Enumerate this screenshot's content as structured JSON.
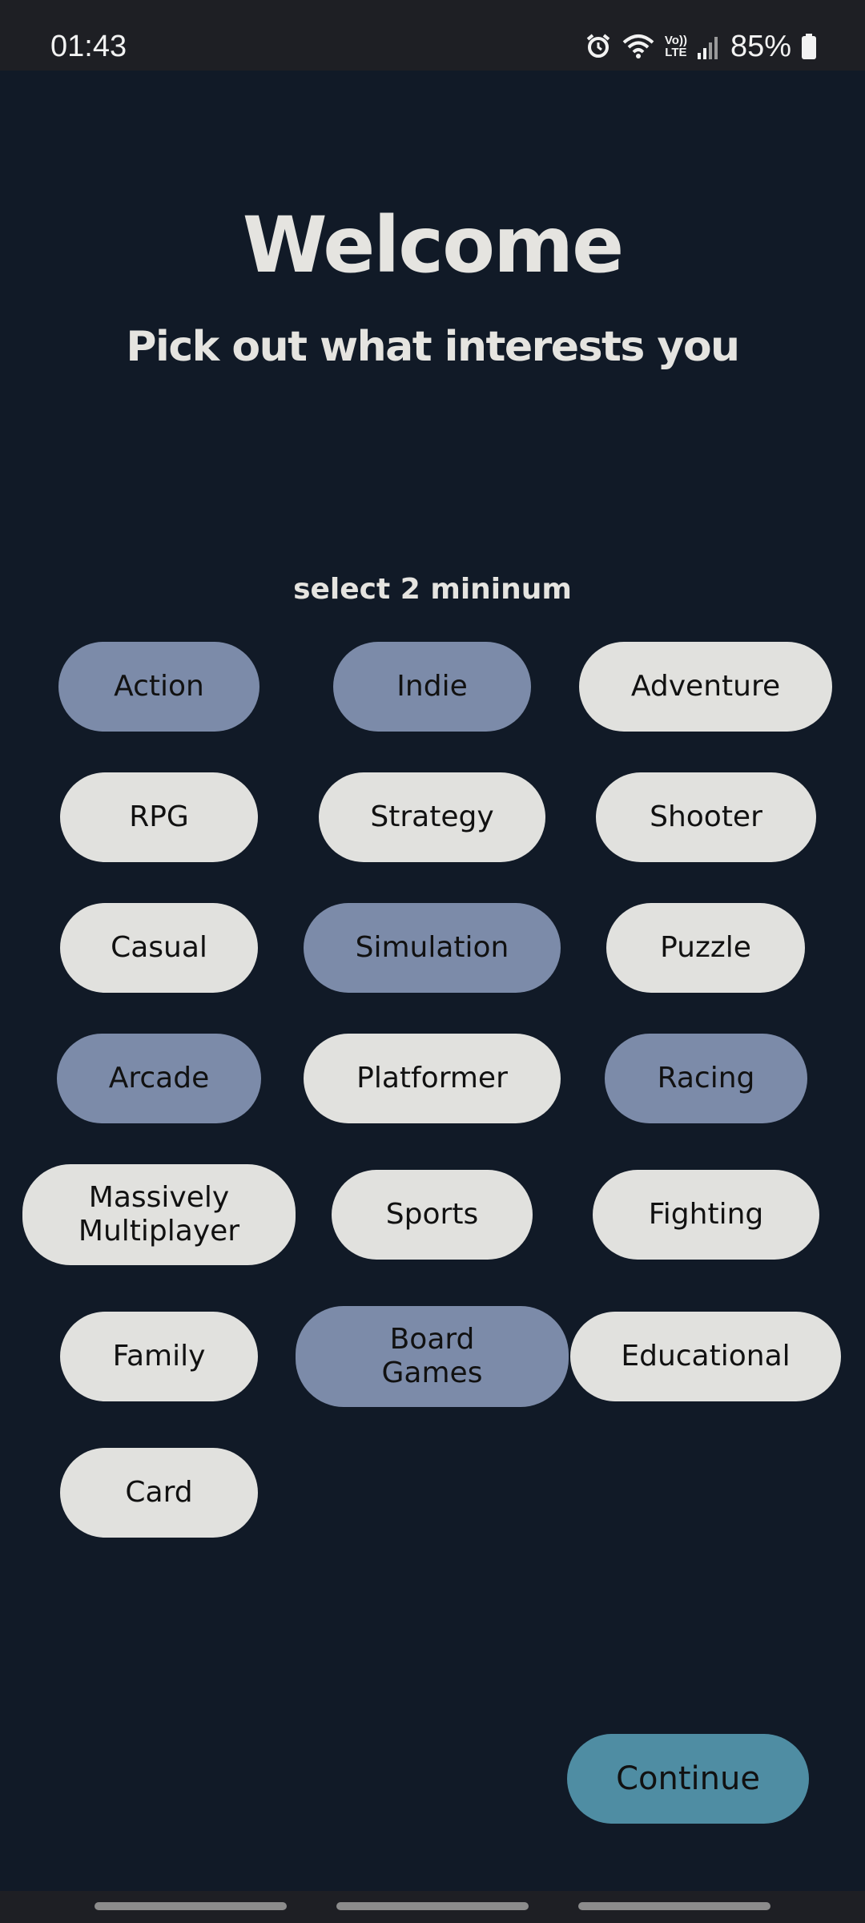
{
  "status_bar": {
    "time": "01:43",
    "network_top": "Vo))",
    "network_bottom": "LTE",
    "battery": "85%"
  },
  "header": {
    "title": "Welcome",
    "subtitle": "Pick out what interests you"
  },
  "hint": "select 2 mininum",
  "colors": {
    "background": "#111a27",
    "chip_selected": "#7c8ba9",
    "chip_unselected": "#e1e1de",
    "continue_button": "#4f8da3"
  },
  "genres": [
    {
      "label": "Action",
      "selected": true
    },
    {
      "label": "Indie",
      "selected": true
    },
    {
      "label": "Adventure",
      "selected": false
    },
    {
      "label": "RPG",
      "selected": false
    },
    {
      "label": "Strategy",
      "selected": false
    },
    {
      "label": "Shooter",
      "selected": false
    },
    {
      "label": "Casual",
      "selected": false
    },
    {
      "label": "Simulation",
      "selected": true
    },
    {
      "label": "Puzzle",
      "selected": false
    },
    {
      "label": "Arcade",
      "selected": true
    },
    {
      "label": "Platformer",
      "selected": false
    },
    {
      "label": "Racing",
      "selected": true
    },
    {
      "label": "Massively\nMultiplayer",
      "selected": false
    },
    {
      "label": "Sports",
      "selected": false
    },
    {
      "label": "Fighting",
      "selected": false
    },
    {
      "label": "Family",
      "selected": false
    },
    {
      "label": "Board\nGames",
      "selected": true
    },
    {
      "label": "Educational",
      "selected": false
    },
    {
      "label": "Card",
      "selected": false
    }
  ],
  "continue_label": "Continue"
}
